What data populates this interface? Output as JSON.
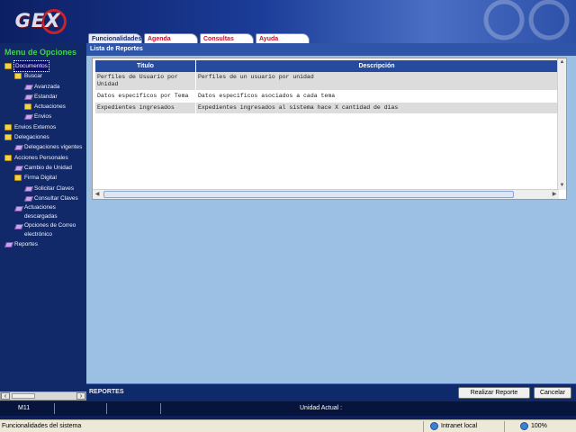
{
  "header": {
    "logo_text": "GEX",
    "tabs": [
      {
        "label": "Funcionalidades",
        "active": true
      },
      {
        "label": "Agenda",
        "active": false
      },
      {
        "label": "Consultas",
        "active": false
      },
      {
        "label": "Ayuda",
        "active": false
      }
    ]
  },
  "sidebar": {
    "title": "Menu de Opciones",
    "items": [
      {
        "label": "Documentos",
        "icon": "open-folder-icon"
      },
      {
        "label": "Buscar",
        "icon": "open-folder-icon"
      },
      {
        "label": "Avanzada",
        "icon": "leaf-icon"
      },
      {
        "label": "Estandar",
        "icon": "leaf-icon"
      },
      {
        "label": "Actuaciones",
        "icon": "folder-icon"
      },
      {
        "label": "Envios",
        "icon": "leaf-icon"
      },
      {
        "label": "Envios Externos",
        "icon": "folder-icon"
      },
      {
        "label": "Delegaciones",
        "icon": "open-folder-icon"
      },
      {
        "label": "Delegaciones vigentes",
        "icon": "leaf-icon"
      },
      {
        "label": "Acciones Personales",
        "icon": "open-folder-icon"
      },
      {
        "label": "Cambio de Unidad",
        "icon": "leaf-icon"
      },
      {
        "label": "Firma Digital",
        "icon": "open-folder-icon"
      },
      {
        "label": "Solicitar Claves",
        "icon": "leaf-icon"
      },
      {
        "label": "Consultar Claves",
        "icon": "leaf-icon"
      },
      {
        "label": "Actuaciones descargadas",
        "icon": "leaf-icon"
      },
      {
        "label": "Opciones de Correo electrónico",
        "icon": "leaf-icon"
      },
      {
        "label": "Reportes",
        "icon": "leaf-icon"
      }
    ]
  },
  "main": {
    "heading": "Lista de Reportes",
    "columns": [
      "Titulo",
      "Descripción"
    ],
    "rows": [
      {
        "title": "Perfiles de Usuario por Unidad",
        "description": "Perfiles de un usuario por unidad"
      },
      {
        "title": "Datos especificos por Tema",
        "description": "Datos especificos asociados a cada tema"
      },
      {
        "title": "Expedientes ingresados",
        "description": "Expedientes ingresados al sistema hace X cantidad de dias"
      }
    ]
  },
  "actions": {
    "section_label": "REPORTES",
    "run_label": "Realizar Reporte",
    "cancel_label": "Cancelar"
  },
  "statusline": {
    "code": "M11",
    "unit_label": "Unidad Actual :"
  },
  "browser_status": {
    "text": "Funcionalidades del sistema",
    "zone": "Intranet local",
    "zoom": "100%"
  },
  "colors": {
    "accent_green": "#3fd34a",
    "tab_red": "#c0102a",
    "header_blue": "#264b9e"
  }
}
